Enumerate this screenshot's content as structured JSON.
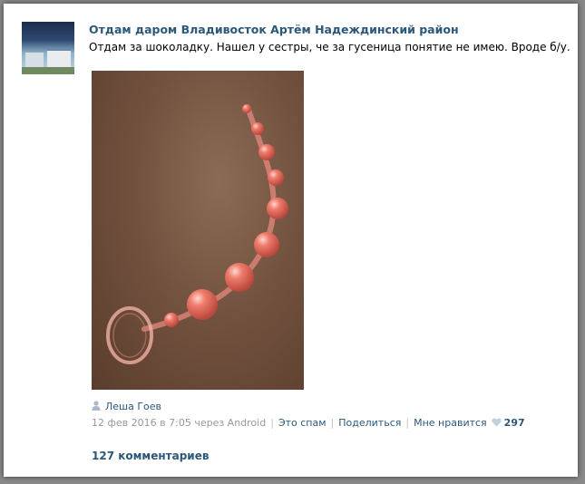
{
  "post": {
    "group_name": "Отдам даром Владивосток Артём Надеждинский район",
    "text": "Отдам за шоколадку. Нашел у сестры, че за гусеница понятие не имею. Вроде б/у.",
    "author": "Леша Гоев",
    "date_line": "12 фев 2016 в 7:05 через Android",
    "actions": {
      "spam": "Это спам",
      "share": "Поделиться",
      "like": "Мне нравится"
    },
    "like_count": "297",
    "comments": "127 комментариев"
  },
  "colors": {
    "link": "#2b587a",
    "muted": "#999999",
    "heart": "#c3d0dc"
  },
  "icons": [
    "user-icon",
    "heart-icon"
  ]
}
